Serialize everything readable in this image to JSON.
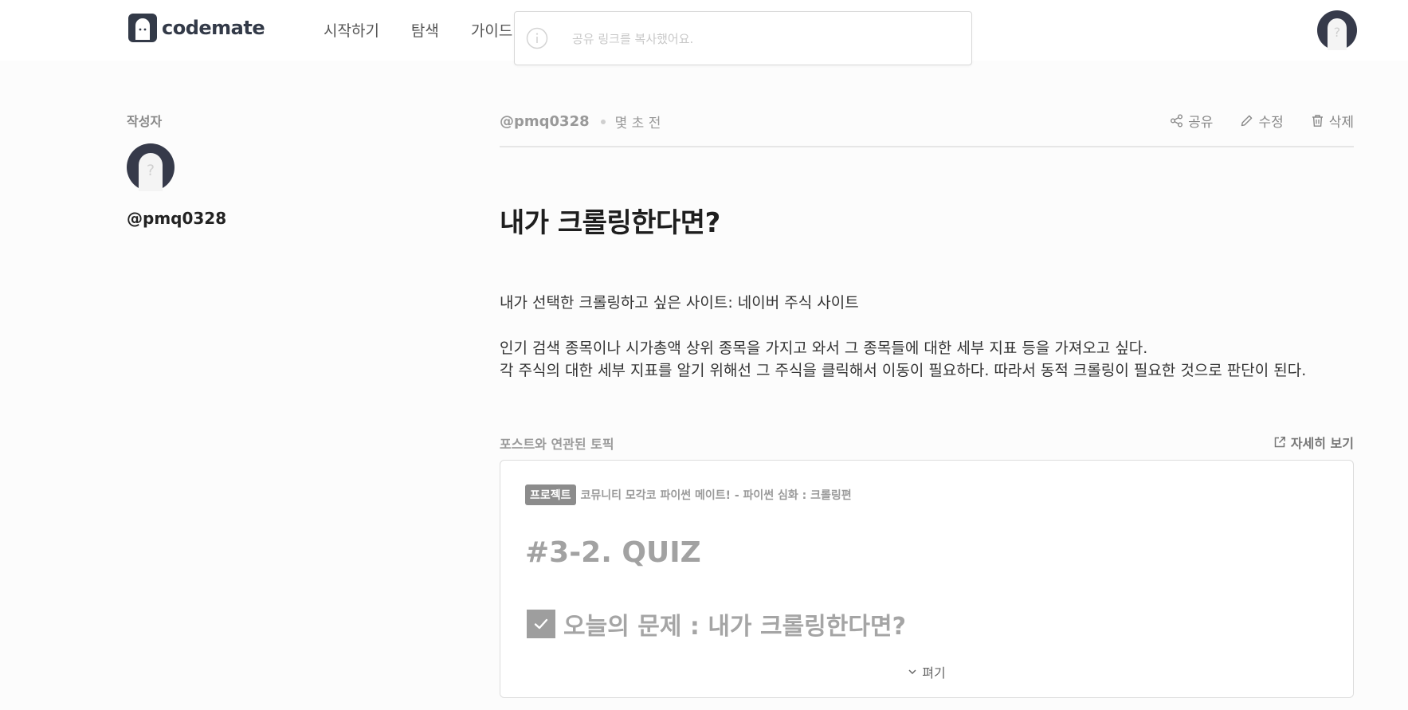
{
  "header": {
    "logo_text": "codemate",
    "nav": [
      "시작하기",
      "탐색",
      "가이드"
    ]
  },
  "toast": {
    "message": "공유 링크를 복사했어요."
  },
  "sidebar": {
    "author_label": "작성자",
    "author_handle": "@pmq0328"
  },
  "post": {
    "author": "@pmq0328",
    "time": "몇 초 전",
    "actions": {
      "share": "공유",
      "edit": "수정",
      "delete": "삭제"
    },
    "title": "내가 크롤링한다면?",
    "body": [
      "내가 선택한 크롤링하고 싶은 사이트: 네이버 주식 사이트",
      "인기 검색 종목이나 시가총액 상위 종목을 가지고 와서 그 종목들에 대한 세부 지표 등을 가져오고 싶다.",
      "각 주식의 대한 세부 지표를 알기 위해선 그 주식을 클릭해서 이동이 필요하다. 따라서 동적 크롤링이 필요한 것으로 판단이 된다."
    ]
  },
  "topic": {
    "label": "포스트와 연관된 토픽",
    "detail_link": "자세히 보기",
    "badge": "프로젝트",
    "crumb": "코뮤니티 모각코 파이썬 메이트! - 파이썬 심화 : 크롤링편",
    "quiz_title": "#3-2. QUIZ",
    "subtitle": "오늘의 문제 : 내가 크롤링한다면?",
    "expand": "펴기"
  },
  "colors": {
    "logo": "#333a48",
    "badge": "#8c8c8c",
    "divider": "#e6e6e6"
  }
}
